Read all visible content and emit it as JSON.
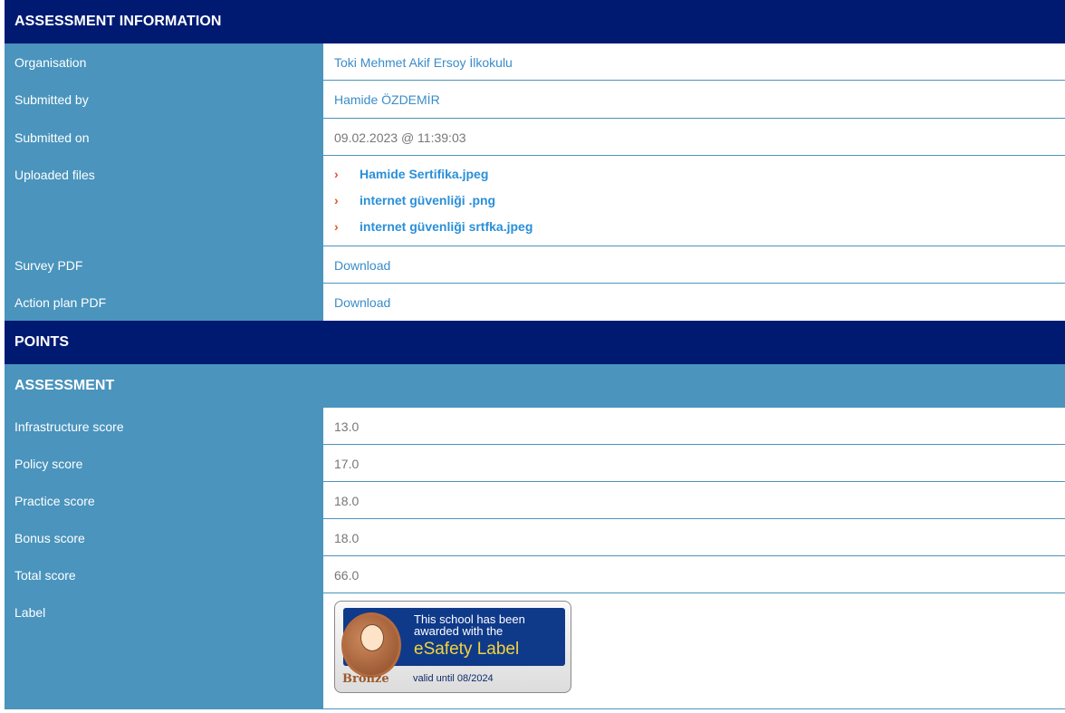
{
  "assessment_info": {
    "header": "ASSESSMENT INFORMATION",
    "organisation": {
      "label": "Organisation",
      "value": "Toki Mehmet Akif Ersoy İlkokulu"
    },
    "submitted_by": {
      "label": "Submitted by",
      "value": "Hamide ÖZDEMİR"
    },
    "submitted_on": {
      "label": "Submitted on",
      "value": "09.02.2023 @ 11:39:03"
    },
    "uploaded_files": {
      "label": "Uploaded files",
      "files": [
        "Hamide Sertifika.jpeg",
        "internet güvenliği .png",
        "internet güvenliği srtfka.jpeg"
      ]
    },
    "survey_pdf": {
      "label": "Survey PDF",
      "value": "Download"
    },
    "action_plan_pdf": {
      "label": "Action plan PDF",
      "value": "Download"
    }
  },
  "points": {
    "header": "POINTS",
    "assessment_header": "ASSESSMENT",
    "scores": [
      {
        "label": "Infrastructure score",
        "value": "13.0"
      },
      {
        "label": "Policy score",
        "value": "17.0"
      },
      {
        "label": "Practice score",
        "value": "18.0"
      },
      {
        "label": "Bonus score",
        "value": "18.0"
      },
      {
        "label": "Total score",
        "value": "66.0"
      }
    ],
    "label_row": {
      "label": "Label",
      "badge_line1": "This school has been",
      "badge_line2": "awarded with the",
      "badge_title": "eSafety Label",
      "badge_level": "Bronze",
      "badge_valid": "valid until 08/2024"
    }
  },
  "colors": {
    "navy": "#001a72",
    "steel_blue": "#4a94bd",
    "link": "#3a8cc9",
    "chevron": "#e0552a"
  }
}
